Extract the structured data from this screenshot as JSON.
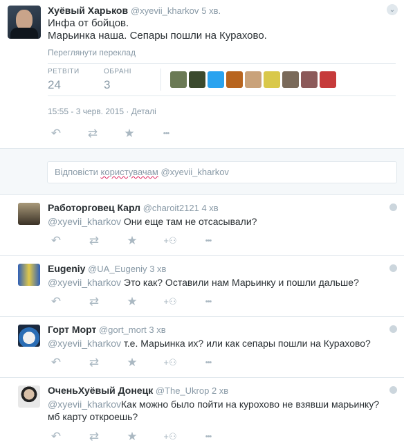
{
  "main_tweet": {
    "author_name": "Хуёвый Харьков",
    "handle": "@xyevii_kharkov",
    "time": "5 хв.",
    "text_lines": [
      "Инфа от бойцов.",
      "Марьинка наша. Сепары пошли на Курахово."
    ],
    "translate_label": "Переглянути переклад",
    "stats": {
      "retweets_label": "РЕТВІТИ",
      "retweets": "24",
      "favorites_label": "ОБРАНІ",
      "favorites": "3"
    },
    "favoriters": [
      {
        "icon": "avatar-1",
        "color": "#6b7a55"
      },
      {
        "icon": "avatar-2",
        "color": "#3b4a2e"
      },
      {
        "icon": "avatar-3",
        "color": "#2aa3ef"
      },
      {
        "icon": "avatar-4",
        "color": "#b8651f"
      },
      {
        "icon": "avatar-5",
        "color": "#c9a27a"
      },
      {
        "icon": "avatar-6",
        "color": "#d9c84a"
      },
      {
        "icon": "avatar-7",
        "color": "#7a6a5a"
      },
      {
        "icon": "avatar-8",
        "color": "#8c5a5a"
      },
      {
        "icon": "avatar-9",
        "color": "#c63a3a"
      }
    ],
    "timestamp": "15:55 - 3 черв. 2015 · Деталі",
    "dismiss_icon": "chevron-down-icon"
  },
  "reply_box": {
    "placeholder_before": "Відповісти ",
    "placeholder_squig": "користувачам",
    "placeholder_after": " @xyevii_kharkov"
  },
  "replies": [
    {
      "name": "Работорговец Карл",
      "handle": "@charoit2121",
      "time": "4 хв",
      "mention": "@xyevii_kharkov",
      "text": " Они еще там не отсасывали?",
      "text2": ""
    },
    {
      "name": "Eugeniy",
      "handle": "@UA_Eugeniy",
      "time": "3 хв",
      "mention": "@xyevii_kharkov",
      "text": " Это как? Оставили нам Марьинку и пошли дальше?",
      "text2": ""
    },
    {
      "name": "Горт Морт",
      "handle": "@gort_mort",
      "time": "3 хв",
      "mention": "@xyevii_kharkov",
      "text": " т.е. Марьинка их? или как сепары пошли на Курахово?",
      "text2": ""
    },
    {
      "name": "ОченьХуёвый Донецк",
      "handle": "@The_Ukrop",
      "time": "2 хв",
      "mention": "@xyevii_kharkov",
      "text": "Как можно было пойти на курохово не взявши марьинку?",
      "text2": "мб карту откроешь?"
    }
  ],
  "icons": {
    "reply": "↶",
    "retweet": "⇄",
    "favorite": "★",
    "follow": "+⚇",
    "more": "•••"
  },
  "colors": {
    "muted": "#8899a6",
    "action_icon": "#aab8c2",
    "border": "#e1e8ed",
    "reply_bg": "#f5f8fa"
  }
}
